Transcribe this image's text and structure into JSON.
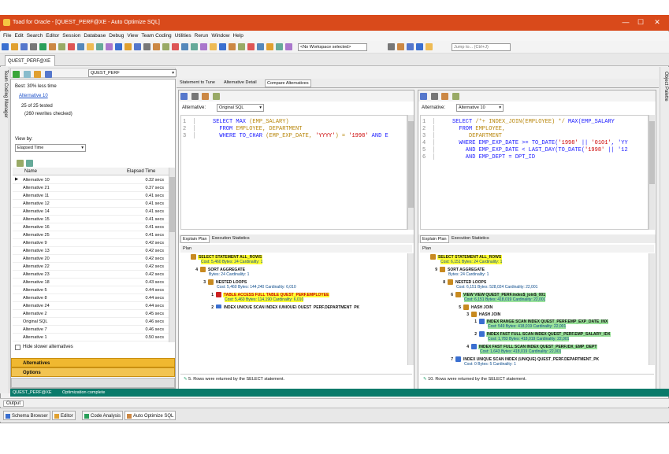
{
  "window": {
    "title": "Toad for Oracle - [QUEST_PERF@XE - Auto Optimize SQL]"
  },
  "menu": [
    "File",
    "Edit",
    "Search",
    "Editor",
    "Session",
    "Database",
    "Debug",
    "View",
    "Team Coding",
    "Utilities",
    "Rerun",
    "Window",
    "Help"
  ],
  "toolbar": {
    "workspace_combo": "<No Workspace selected>",
    "jump_placeholder": "Jump to... (Ctrl+J)"
  },
  "connection_tab": "QUEST_PERF@XE",
  "schema_combo": "QUEST_PERF",
  "side_tabs": {
    "left": "Team Coding Manager",
    "right": "Object Palette"
  },
  "left": {
    "best": "Best: 30% less time",
    "best_link": "Alternative 10",
    "tested": "25 of 25 tested",
    "rewrites": "(260 rewrites checked)",
    "viewby_label": "View by:",
    "viewby_value": "Elapsed Time",
    "col_name": "Name",
    "col_elapsed": "Elapsed Time",
    "rows": [
      [
        "Alternative 10",
        "0.32 secs"
      ],
      [
        "Alternative 21",
        "0.37 secs"
      ],
      [
        "Alternative 11",
        "0.41 secs"
      ],
      [
        "Alternative 12",
        "0.41 secs"
      ],
      [
        "Alternative 14",
        "0.41 secs"
      ],
      [
        "Alternative 15",
        "0.41 secs"
      ],
      [
        "Alternative 16",
        "0.41 secs"
      ],
      [
        "Alternative 25",
        "0.41 secs"
      ],
      [
        "Alternative 9",
        "0.42 secs"
      ],
      [
        "Alternative 13",
        "0.42 secs"
      ],
      [
        "Alternative 20",
        "0.42 secs"
      ],
      [
        "Alternative 22",
        "0.42 secs"
      ],
      [
        "Alternative 23",
        "0.42 secs"
      ],
      [
        "Alternative 18",
        "0.43 secs"
      ],
      [
        "Alternative 5",
        "0.44 secs"
      ],
      [
        "Alternative 8",
        "0.44 secs"
      ],
      [
        "Alternative 24",
        "0.44 secs"
      ],
      [
        "Alternative 2",
        "0.45 secs"
      ],
      [
        "Original SQL",
        "0.46 secs"
      ],
      [
        "Alternative 7",
        "0.46 secs"
      ],
      [
        "Alternative 1",
        "0.50 secs"
      ]
    ],
    "hide_slower": "Hide slower alternatives",
    "sec_alternatives": "Alternatives",
    "sec_options": "Options"
  },
  "center_tabs": [
    "Statement to Tune",
    "Alternative Detail",
    "Compare Alternatives"
  ],
  "left_pane": {
    "alt_label": "Alternative:",
    "alt_value": "Original SQL",
    "sql_lines": [
      {
        "n": "1",
        "parts": [
          [
            "kw",
            "SELECT MAX "
          ],
          [
            "tx",
            "(EMP_SALARY)"
          ]
        ]
      },
      {
        "n": "2",
        "parts": [
          [
            "kw",
            "  FROM "
          ],
          [
            "tx",
            "EMPLOYEE, DEPARTMENT"
          ]
        ]
      },
      {
        "n": "3",
        "parts": [
          [
            "kw",
            "  WHERE TO_CHAR "
          ],
          [
            "tx",
            "(EMP_EXP_DATE, "
          ],
          [
            "str",
            "'YYYY'"
          ],
          [
            "tx",
            ") = "
          ],
          [
            "str",
            "'1998'"
          ],
          [
            "kw",
            " AND E"
          ]
        ]
      }
    ],
    "plan_tabs": [
      "Explain Plan",
      "Execution Statistics"
    ],
    "plan_header": "Plan",
    "plan": [
      {
        "indent": 0,
        "num": "",
        "label": "SELECT STATEMENT  ALL_ROWS",
        "detail": "Cost: 5,460  Bytes: 24  Cardinality: 1",
        "hl": "yellow"
      },
      {
        "indent": 1,
        "num": "4",
        "label": "SORT AGGREGATE",
        "detail": "Bytes: 24  Cardinality: 1",
        "hl": ""
      },
      {
        "indent": 2,
        "num": "3",
        "label": "NESTED LOOPS",
        "detail": "Cost: 5,460  Bytes: 144,240  Cardinality: 6,010",
        "hl": ""
      },
      {
        "indent": 3,
        "num": "1",
        "label": "TABLE ACCESS FULL TABLE QUEST_PERF.EMPLOYEE",
        "detail": "Cost: 5,460  Bytes: 114,190  Cardinality: 6,010",
        "hl": "yellow"
      },
      {
        "indent": 3,
        "num": "2",
        "label": "INDEX UNIQUE SCAN INDEX (UNIQUE) QUEST_PERF.DEPARTMENT_PK",
        "detail": "",
        "hl": ""
      }
    ],
    "msg": "5.  Rows were returned by the SELECT statement."
  },
  "right_pane": {
    "alt_label": "Alternative:",
    "alt_value": "Alternative 10",
    "sql_lines": [
      {
        "n": "1",
        "parts": [
          [
            "kw",
            "SELECT "
          ],
          [
            "tx",
            "/*+ INDEX_JOIN(EMPLOYEE) */ "
          ],
          [
            "kw",
            "MAX(EMP_SALARY"
          ]
        ]
      },
      {
        "n": "2",
        "parts": [
          [
            "kw",
            "  FROM "
          ],
          [
            "tx",
            "EMPLOYEE,"
          ]
        ]
      },
      {
        "n": "3",
        "parts": [
          [
            "tx",
            "     DEPARTMENT"
          ]
        ]
      },
      {
        "n": "4",
        "parts": [
          [
            "kw",
            "  WHERE EMP_EXP_DATE >= TO_DATE("
          ],
          [
            "str",
            "'1998'"
          ],
          [
            "kw",
            " || "
          ],
          [
            "str",
            "'0101'"
          ],
          [
            "kw",
            ", 'YY"
          ]
        ]
      },
      {
        "n": "5",
        "parts": [
          [
            "kw",
            "    AND EMP_EXP_DATE < LAST_DAY(TO_DATE("
          ],
          [
            "str",
            "'1998'"
          ],
          [
            "kw",
            " || '12"
          ]
        ]
      },
      {
        "n": "6",
        "parts": [
          [
            "kw",
            "    AND EMP_DEPT = DPT_ID"
          ]
        ]
      }
    ],
    "plan_tabs": [
      "Explain Plan",
      "Execution Statistics"
    ],
    "plan_header": "Plan",
    "plan": [
      {
        "indent": 0,
        "num": "",
        "label": "SELECT STATEMENT  ALL_ROWS",
        "detail": "Cost: 6,151  Bytes: 24  Cardinality: 1",
        "hl": "yellow"
      },
      {
        "indent": 1,
        "num": "9",
        "label": "SORT AGGREGATE",
        "detail": "Bytes: 24  Cardinality: 1",
        "hl": ""
      },
      {
        "indent": 2,
        "num": "8",
        "label": "NESTED LOOPS",
        "detail": "Cost: 6,151  Bytes: 528,024  Cardinality: 22,001",
        "hl": ""
      },
      {
        "indent": 3,
        "num": "6",
        "label": "VIEW VIEW QUEST_PERF.index$_join$_001",
        "detail": "Cost: 6,151  Bytes: 418,019  Cardinality: 22,001",
        "hl": "green"
      },
      {
        "indent": 4,
        "num": "5",
        "label": "HASH JOIN",
        "detail": "",
        "hl": ""
      },
      {
        "indent": 5,
        "num": "3",
        "label": "HASH JOIN",
        "detail": "",
        "hl": ""
      },
      {
        "indent": 6,
        "num": "1",
        "label": "INDEX RANGE SCAN INDEX QUEST_PERF.EMP_EXP_DATE_INX",
        "detail": "Cost: 549  Bytes: 418,019  Cardinality: 22,001",
        "hl": "green"
      },
      {
        "indent": 6,
        "num": "2",
        "label": "INDEX FAST FULL SCAN INDEX QUEST_PERF.EMP_SALARY_IDX",
        "detail": "Cost: 1,783  Bytes: 418,019  Cardinality: 22,001",
        "hl": "green"
      },
      {
        "indent": 5,
        "num": "4",
        "label": "INDEX FAST FULL SCAN INDEX QUEST_PERF.IDX_EMP_DEPT",
        "detail": "Cost: 1,643  Bytes: 418,019  Cardinality: 22,001",
        "hl": "green"
      },
      {
        "indent": 3,
        "num": "7",
        "label": "INDEX UNIQUE SCAN INDEX (UNIQUE) QUEST_PERF.DEPARTMENT_PK",
        "detail": "Cost: 0  Bytes: 5  Cardinality: 1",
        "hl": ""
      }
    ],
    "msg": "10.  Rows were returned by the SELECT statement."
  },
  "status": {
    "conn": "QUEST_PERF@XE",
    "msg": "Optimization complete"
  },
  "output_tab": "Output",
  "bottom_tabs": [
    "Schema Browser",
    "Editor",
    "Code Analysis",
    "Auto Optimize SQL"
  ],
  "colors": {
    "title": "#d94a1b",
    "status": "#0a7a6a",
    "section": "#f0b830",
    "yellow": "#ffff33",
    "green": "#9be39b"
  }
}
